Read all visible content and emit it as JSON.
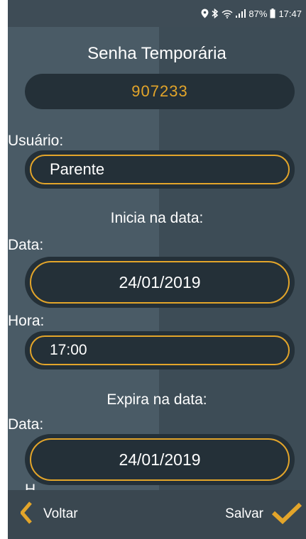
{
  "status_bar": {
    "battery": "87%",
    "time": "17:47",
    "icons": [
      "location-icon",
      "bluetooth-icon",
      "wifi-icon",
      "signal-icon",
      "battery-icon"
    ]
  },
  "form": {
    "title": "Senha Temporária",
    "temp_code": "907233",
    "user_label": "Usuário:",
    "user_value": "Parente",
    "start_section": "Inicia na data:",
    "start_date_label": "Data:",
    "start_date_value": "24/01/2019",
    "start_time_label": "Hora:",
    "start_time_value": "17:00",
    "end_section": "Expira na data:",
    "end_date_label": "Data:",
    "end_date_value": "24/01/2019",
    "end_time_label": "Hora:"
  },
  "bottom_bar": {
    "back_label": "Voltar",
    "save_label": "Salvar"
  },
  "colors": {
    "accent": "#e3a52a",
    "background": "#4a5b66",
    "field_bg": "#243038"
  }
}
